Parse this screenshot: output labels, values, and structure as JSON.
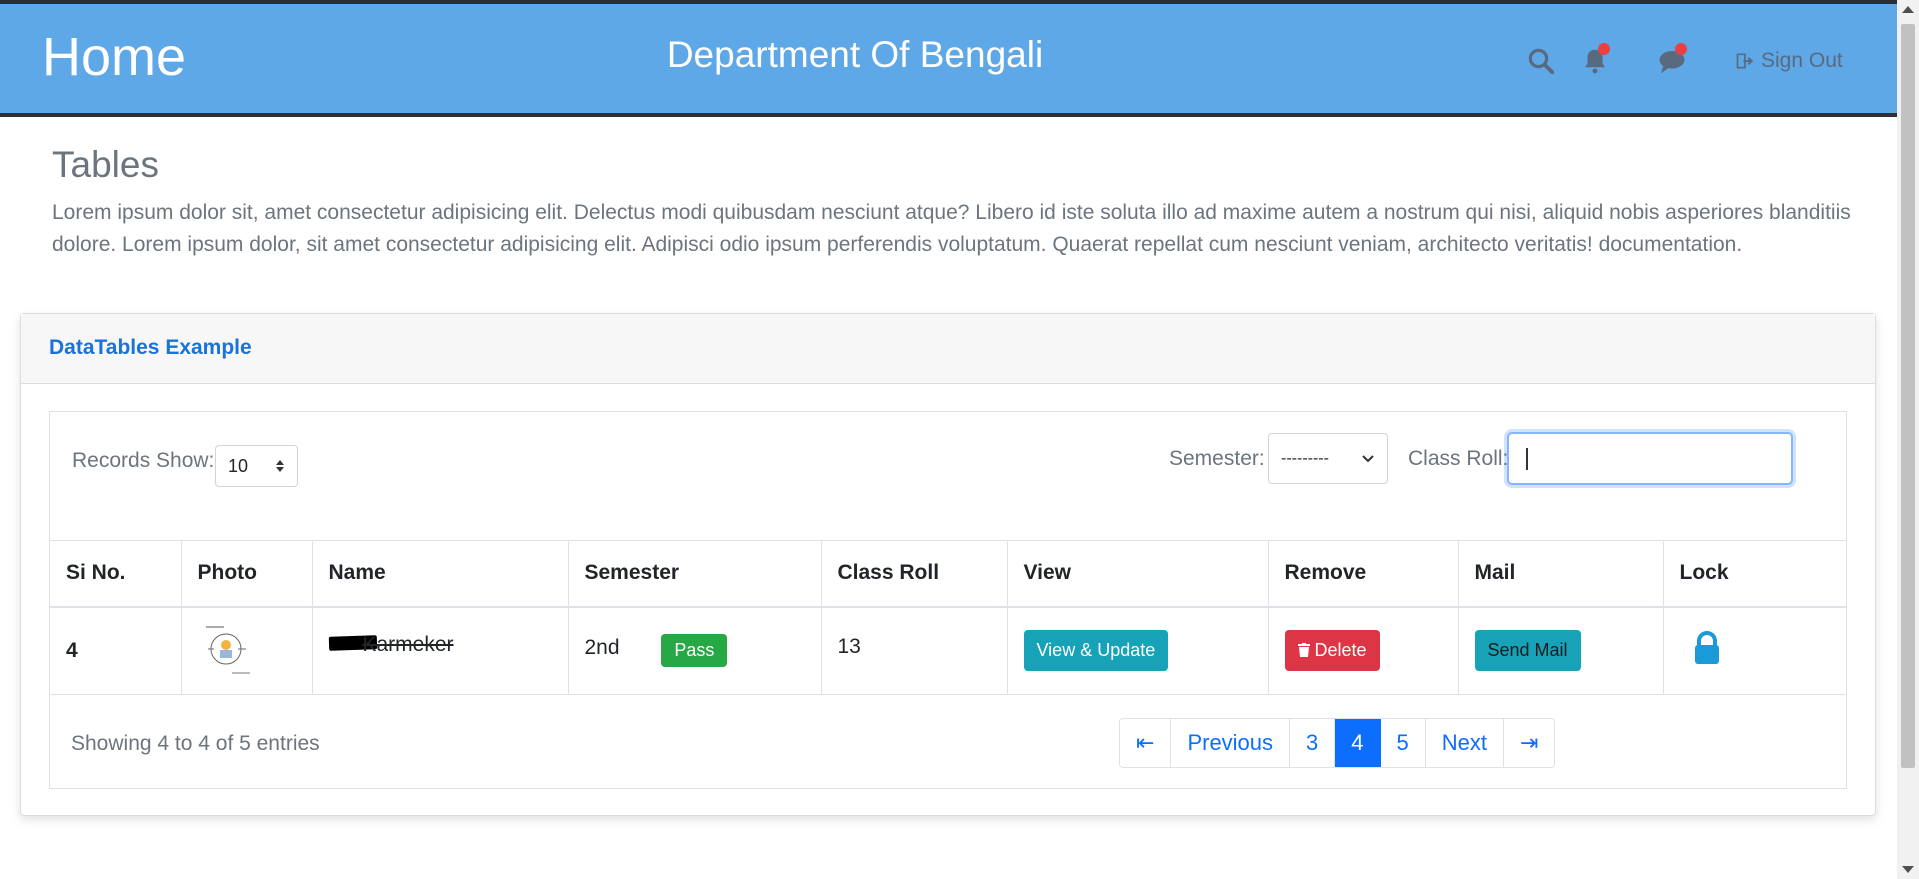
{
  "navbar": {
    "brand": "Home",
    "title": "Department Of Bengali",
    "icons": [
      "search-icon",
      "bell-icon",
      "chat-icon"
    ],
    "signout_label": "Sign Out"
  },
  "page": {
    "title": "Tables",
    "description": "Lorem ipsum dolor sit, amet consectetur adipisicing elit. Delectus modi quibusdam nesciunt atque? Libero id iste soluta illo ad maxime autem a nostrum qui nisi, aliquid nobis asperiores blanditiis dolore. Lorem ipsum dolor, sit amet consectetur adipisicing elit. Adipisci odio ipsum perferendis voluptatum. Quaerat repellat cum nesciunt veniam, architecto veritatis! documentation."
  },
  "card": {
    "header": "DataTables Example"
  },
  "controls": {
    "records_label": "Records Show:",
    "records_value": "10",
    "semester_label": "Semester:",
    "semester_value": "---------",
    "classroll_label": "Class Roll:",
    "classroll_value": ""
  },
  "table": {
    "headers": [
      "Si No.",
      "Photo",
      "Name",
      "Semester",
      "Class Roll",
      "View",
      "Remove",
      "Mail",
      "Lock"
    ],
    "rows": [
      {
        "si": "4",
        "name": "Karmeker",
        "semester": "2nd",
        "status": "Pass",
        "class_roll": "13",
        "view_label": "View & Update",
        "remove_label": "Delete",
        "mail_label": "Send Mail"
      }
    ]
  },
  "footer": {
    "showing": "Showing 4 to 4 of 5 entries",
    "pages": [
      "⇤",
      "Previous",
      "3",
      "4",
      "5",
      "Next",
      "⇥"
    ],
    "active_page": "4"
  },
  "colors": {
    "navbar": "#5ea8e8",
    "accent": "#0d6efd",
    "success": "#28a745",
    "danger": "#dc3545",
    "info": "#17a2b8"
  }
}
